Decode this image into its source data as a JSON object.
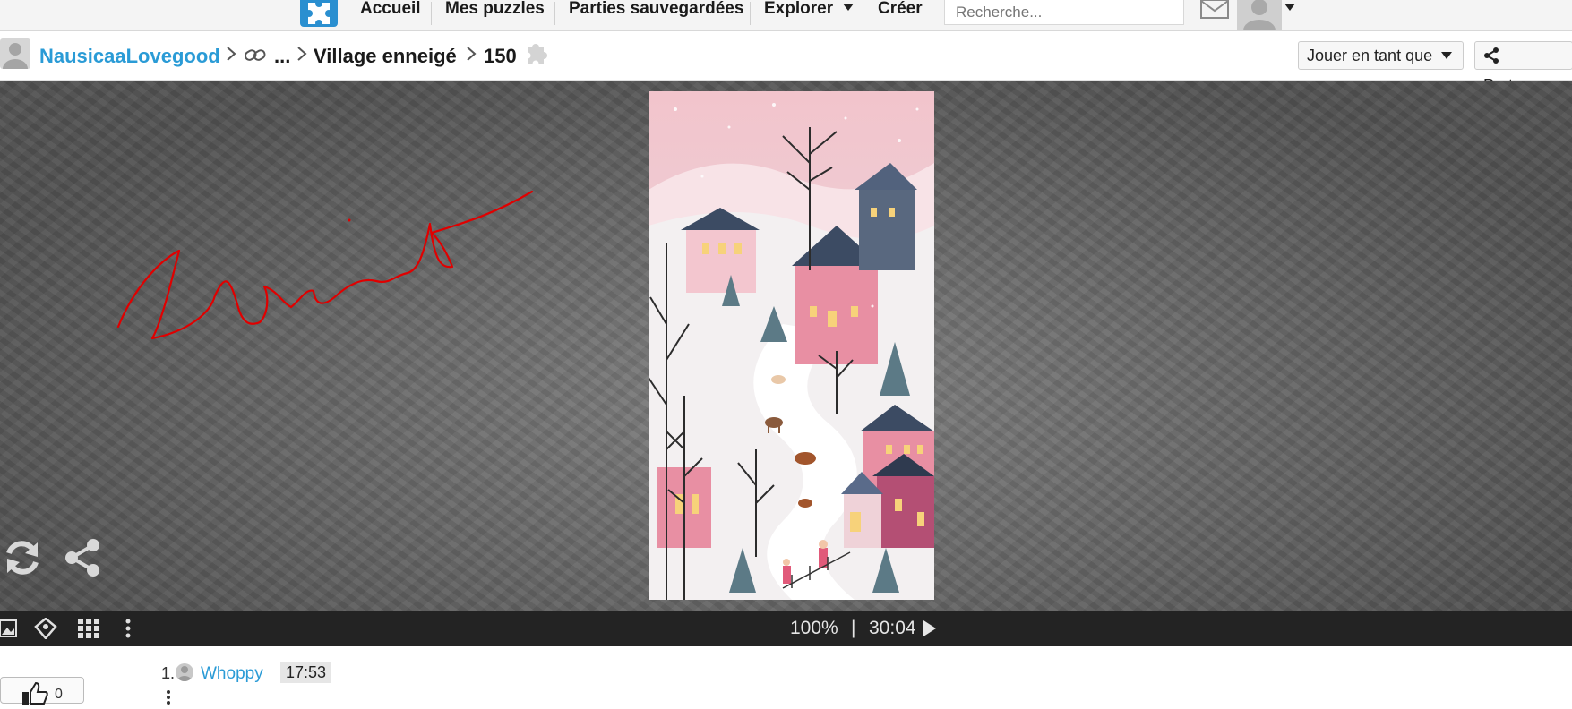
{
  "nav": {
    "items": [
      "Accueil",
      "Mes puzzles",
      "Parties sauvegardées",
      "Explorer",
      "Créer"
    ],
    "search_placeholder": "Recherche..."
  },
  "breadcrumb": {
    "user": "NausicaaLovegood",
    "collection": "...",
    "puzzle_title": "Village enneigé",
    "piece_count": "150",
    "play_as_label": "Jouer en tant que",
    "share_label": "Partager"
  },
  "status": {
    "zoom": "100%",
    "separator": "|",
    "timer": "30:04"
  },
  "leaderboard": {
    "rank": "1.",
    "user": "Whoppy",
    "time": "17:53",
    "likes": "0"
  },
  "icons": [
    "puzzle-logo-icon",
    "mail-icon",
    "user-avatar-icon",
    "link-icon",
    "puzzle-piece-icon",
    "share-icon",
    "refresh-icon",
    "image-icon",
    "palette-icon",
    "grid-icon",
    "more-vertical-icon",
    "play-icon",
    "thumbs-up-icon"
  ],
  "colors": {
    "link": "#2a9bd6",
    "bottombar": "#232323",
    "scribble": "#e00000"
  }
}
